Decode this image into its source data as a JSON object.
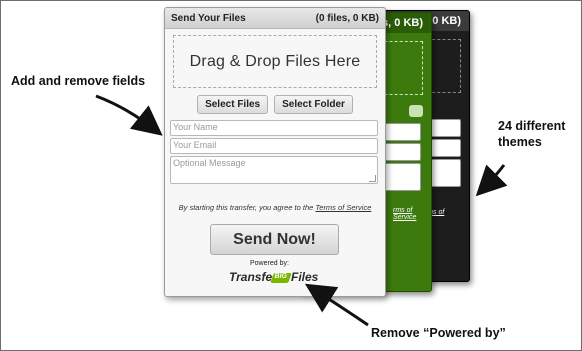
{
  "annotations": {
    "add_remove": "Add and remove fields",
    "themes_line1": "24 different",
    "themes_line2": "themes",
    "remove_powered": "Remove “Powered by”"
  },
  "theme_panels": {
    "black_header": "(0 files, 0 KB)",
    "black_drop_partial": "ere",
    "black_terms_partial": "erms of",
    "green_header": "(0 files, 0 KB)",
    "green_drop_partial": "ere",
    "green_terms_partial": "rms of Service"
  },
  "widget": {
    "title": "Send Your Files",
    "file_count": "(0 files, 0 KB)",
    "dropzone": "Drag & Drop Files Here",
    "select_files": "Select Files",
    "select_folder": "Select Folder",
    "name_placeholder": "Your Name",
    "email_placeholder": "Your Email",
    "message_placeholder": "Optional Message",
    "terms_text": "By starting this transfer, you agree to the",
    "terms_link": "Terms of Service",
    "send_button": "Send Now!",
    "powered_by": "Powered by:",
    "logo_part1": "Transfer",
    "logo_mark": "BIG",
    "logo_part2": "Files"
  },
  "colors": {
    "green_theme": "#3d7a0e",
    "black_theme": "#1d1d1d",
    "logo_accent": "#7ab800"
  }
}
